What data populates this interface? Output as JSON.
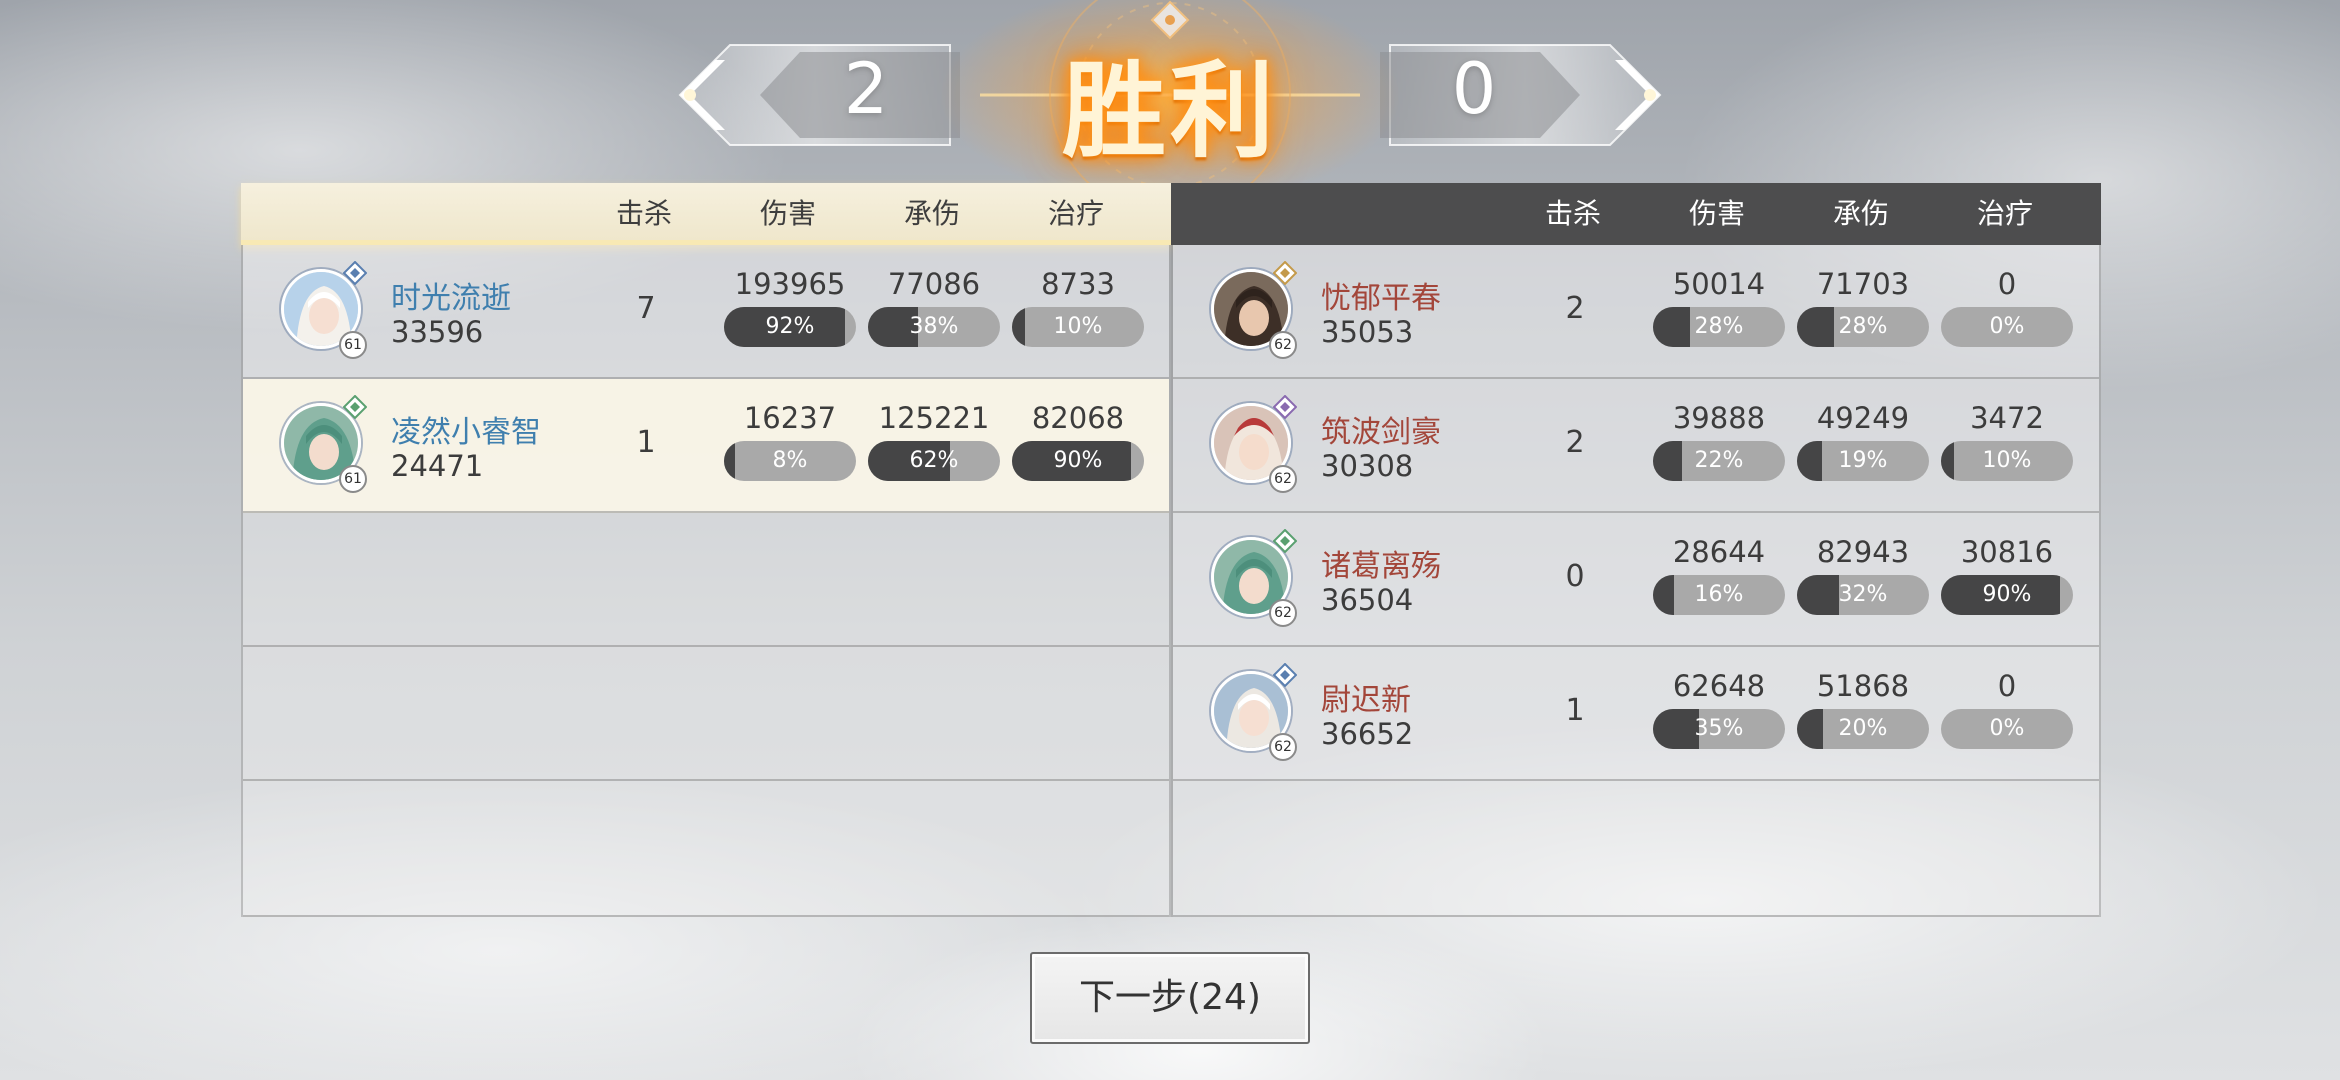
{
  "result": {
    "title": "胜利",
    "left_score": "2",
    "right_score": "0"
  },
  "columns": {
    "kills": "击杀",
    "damage": "伤害",
    "taken": "承伤",
    "heal": "治疗"
  },
  "left_team": [
    {
      "name": "时光流逝",
      "power": "33596",
      "level": "61",
      "kills": "7",
      "damage": "193965",
      "damage_pct": "92%",
      "damage_frac": 0.92,
      "taken": "77086",
      "taken_pct": "38%",
      "taken_frac": 0.38,
      "heal": "8733",
      "heal_pct": "10%",
      "heal_frac": 0.1
    },
    {
      "name": "凌然小睿智",
      "power": "24471",
      "level": "61",
      "kills": "1",
      "damage": "16237",
      "damage_pct": "8%",
      "damage_frac": 0.08,
      "taken": "125221",
      "taken_pct": "62%",
      "taken_frac": 0.62,
      "heal": "82068",
      "heal_pct": "90%",
      "heal_frac": 0.9
    }
  ],
  "right_team": [
    {
      "name": "忧郁平春",
      "power": "35053",
      "level": "62",
      "kills": "2",
      "damage": "50014",
      "damage_pct": "28%",
      "damage_frac": 0.28,
      "taken": "71703",
      "taken_pct": "28%",
      "taken_frac": 0.28,
      "heal": "0",
      "heal_pct": "0%",
      "heal_frac": 0
    },
    {
      "name": "筑波剑豪",
      "power": "30308",
      "level": "62",
      "kills": "2",
      "damage": "39888",
      "damage_pct": "22%",
      "damage_frac": 0.22,
      "taken": "49249",
      "taken_pct": "19%",
      "taken_frac": 0.19,
      "heal": "3472",
      "heal_pct": "10%",
      "heal_frac": 0.1
    },
    {
      "name": "诸葛离殇",
      "power": "36504",
      "level": "62",
      "kills": "0",
      "damage": "28644",
      "damage_pct": "16%",
      "damage_frac": 0.16,
      "taken": "82943",
      "taken_pct": "32%",
      "taken_frac": 0.32,
      "heal": "30816",
      "heal_pct": "90%",
      "heal_frac": 0.9
    },
    {
      "name": "尉迟新",
      "power": "36652",
      "level": "62",
      "kills": "1",
      "damage": "62648",
      "damage_pct": "35%",
      "damage_frac": 0.35,
      "taken": "51868",
      "taken_pct": "20%",
      "taken_frac": 0.2,
      "heal": "0",
      "heal_pct": "0%",
      "heal_frac": 0
    }
  ],
  "next_button": {
    "label": "下一步(24)"
  },
  "colors": {
    "left_name": "#3f7fae",
    "right_name": "#a3463a",
    "bar_fill": "#454546",
    "bar_track": "#a9a9a9",
    "title_glow": "#ff9a1f"
  }
}
